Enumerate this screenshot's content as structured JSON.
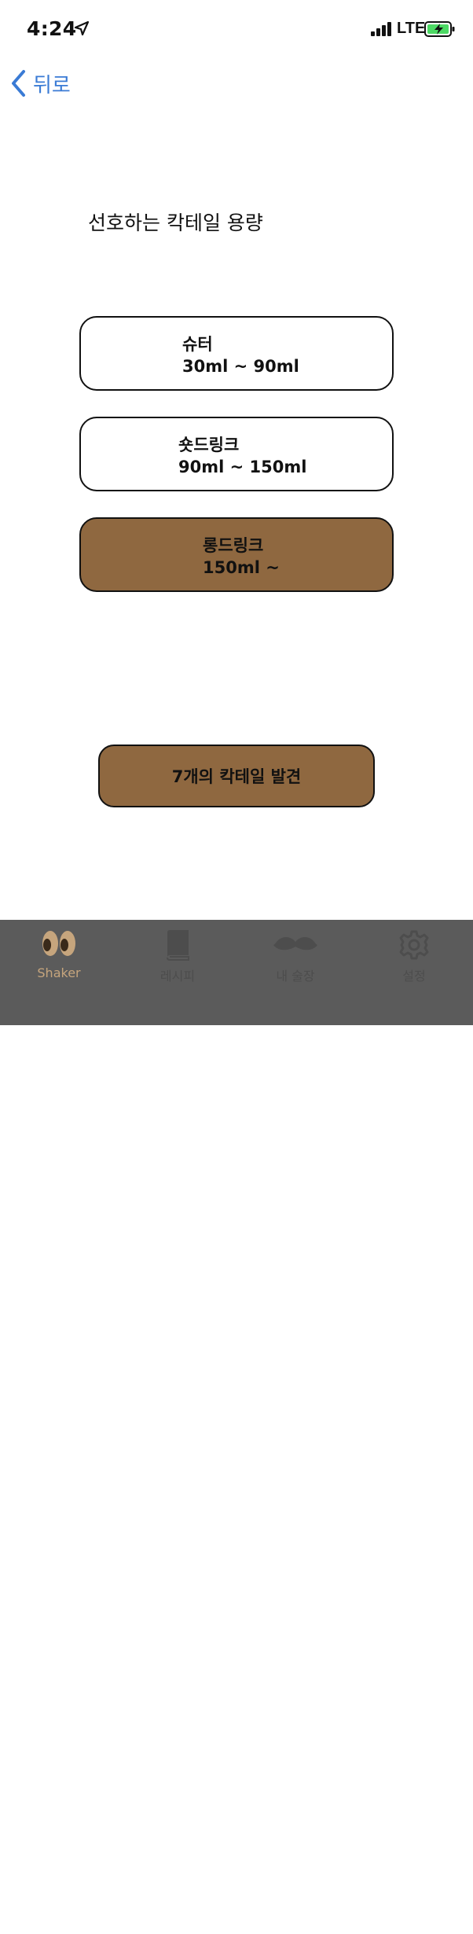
{
  "status_bar": {
    "time": "4:24",
    "network": "LTE"
  },
  "nav": {
    "back_label": "뒤로"
  },
  "title": "선호하는 칵테일 용량",
  "options": [
    {
      "name": "슈터",
      "range": "30ml ~ 90ml",
      "selected": false
    },
    {
      "name": "숏드링크",
      "range": "90ml ~ 150ml",
      "selected": false
    },
    {
      "name": "롱드링크",
      "range": "150ml ~",
      "selected": true
    }
  ],
  "result_button": {
    "label": "7개의 칵테일 발견"
  },
  "tab_bar": {
    "items": [
      {
        "label": "Shaker",
        "icon": "eyes-icon",
        "active": true
      },
      {
        "label": "레시피",
        "icon": "book-icon",
        "active": false
      },
      {
        "label": "내 술장",
        "icon": "mustache-icon",
        "active": false
      },
      {
        "label": "설정",
        "icon": "gear-icon",
        "active": false
      }
    ]
  },
  "colors": {
    "accent_brown": "#8f6840",
    "link_blue": "#3a7bd5",
    "tab_bar_bg": "#5b5b5b",
    "tab_active": "#c6a57d",
    "tab_inactive": "#4d4d4d"
  }
}
